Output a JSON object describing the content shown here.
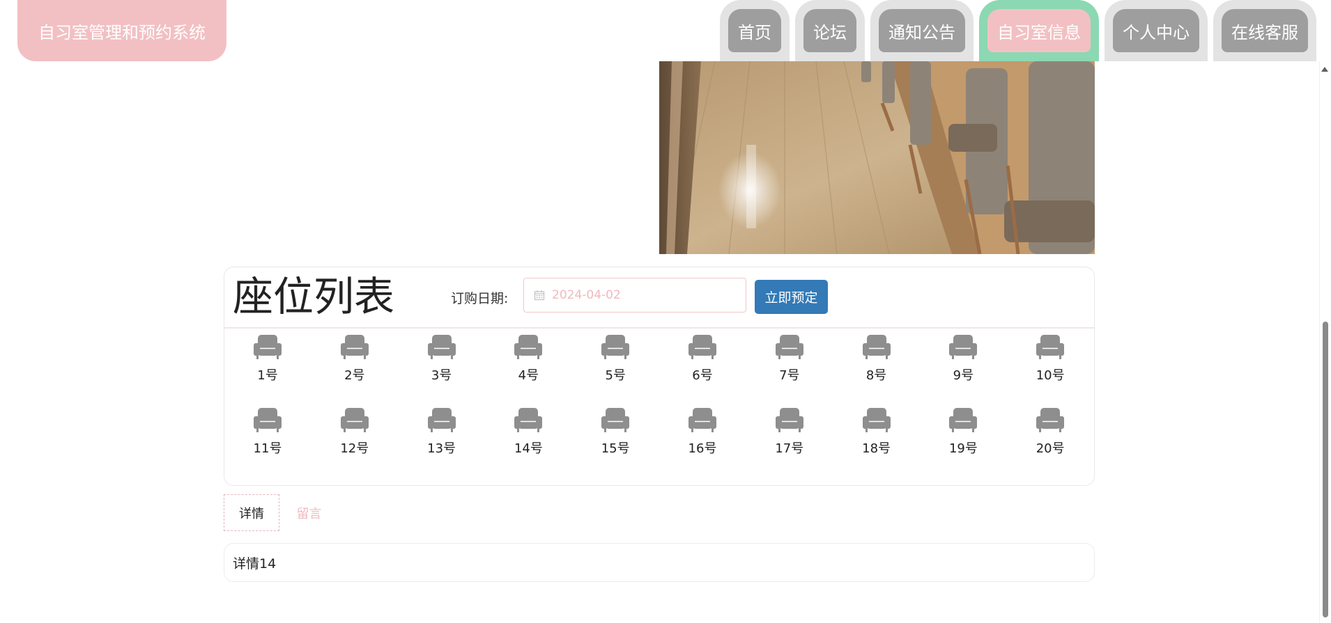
{
  "header": {
    "logo_text": "自习室管理和预约系统",
    "nav": [
      {
        "label": "首页"
      },
      {
        "label": "论坛"
      },
      {
        "label": "通知公告"
      },
      {
        "label": "自习室信息",
        "active": true
      },
      {
        "label": "个人中心"
      },
      {
        "label": "在线客服"
      }
    ]
  },
  "seat_panel": {
    "title": "座位列表",
    "date_label": "订购日期:",
    "date_value": "2024-04-02",
    "book_button": "立即预定",
    "seats": [
      "1号",
      "2号",
      "3号",
      "4号",
      "5号",
      "6号",
      "7号",
      "8号",
      "9号",
      "10号",
      "11号",
      "12号",
      "13号",
      "14号",
      "15号",
      "16号",
      "17号",
      "18号",
      "19号",
      "20号"
    ]
  },
  "tabs": {
    "detail": "详情",
    "comment": "留言"
  },
  "detail_content": "详情14",
  "colors": {
    "brand_pink": "#f2c0c3",
    "active_border": "#8cd8b2",
    "nav_inactive": "#9e9e9e",
    "primary_button": "#337ab7",
    "seat_icon": "#8e8e8e"
  },
  "icons": {
    "seat": "armchair-icon",
    "date": "calendar-icon"
  }
}
